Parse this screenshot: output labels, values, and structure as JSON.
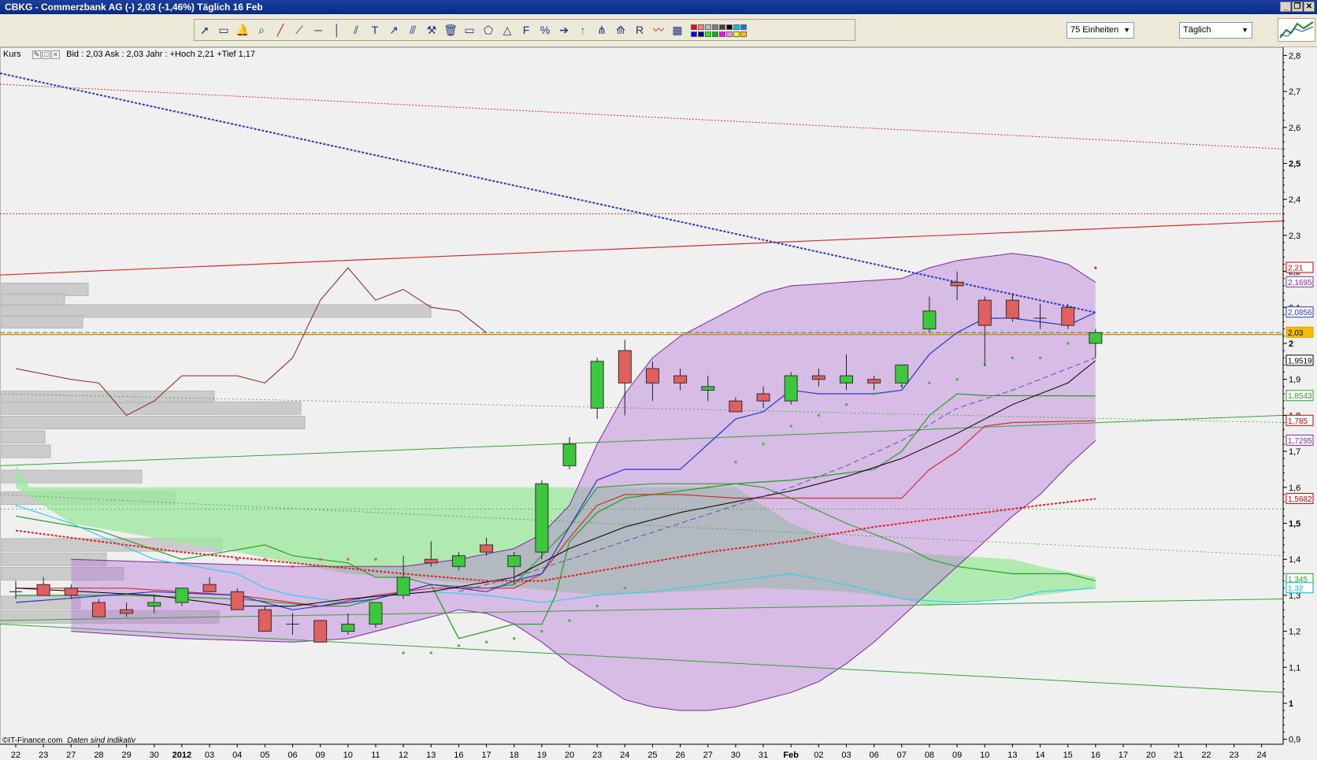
{
  "window": {
    "title": "CBKG - Commerzbank AG (-)   2,03 (-1,46%)   Täglich  16 Feb"
  },
  "toolbar": {
    "units_select": "75 Einheiten",
    "interval_select": "Täglich",
    "tools": [
      "cursor-icon",
      "ruler-icon",
      "alarm-bell-icon",
      "zoom-icon",
      "trendline-icon",
      "ray-icon",
      "horizontal-line-icon",
      "vertical-line-icon",
      "channel-icon",
      "text-icon",
      "arrow-line-icon",
      "parallel-icon",
      "tools-icon",
      "trash-icon",
      "rectangle-icon",
      "polygon-icon",
      "triangle-icon",
      "fibonacci-icon",
      "percent-icon",
      "arrow-right-icon",
      "arrow-up-icon",
      "fork-icon",
      "fan-icon",
      "raff-icon",
      "indicator-icon",
      "chart-type-icon"
    ],
    "colors": [
      "#ff0000",
      "#ff8080",
      "#c0c0c0",
      "#808080",
      "#404040",
      "#000000",
      "#00c0ff",
      "#0080ff",
      "#0000ff",
      "#000080",
      "#00ff00",
      "#00c000",
      "#ff00ff",
      "#ff80ff",
      "#ffff00",
      "#ffc000"
    ]
  },
  "info": {
    "label": "Kurs",
    "text": "Bid : 2,03 Ask : 2,03  Jahr : +Hoch 2,21 +Tief 1,17"
  },
  "footer": {
    "source": "©IT-Finance.com",
    "note": "Daten sind indikativ"
  },
  "chart_data": {
    "type": "candlestick",
    "x_tick_labels": [
      "22",
      "23",
      "27",
      "28",
      "29",
      "30",
      "2012",
      "03",
      "04",
      "05",
      "06",
      "09",
      "10",
      "11",
      "12",
      "13",
      "16",
      "17",
      "18",
      "19",
      "20",
      "23",
      "24",
      "25",
      "26",
      "27",
      "30",
      "31",
      "Feb",
      "02",
      "03",
      "06",
      "07",
      "08",
      "09",
      "10",
      "13",
      "14",
      "15",
      "16",
      "17",
      "20",
      "21",
      "22",
      "23",
      "24"
    ],
    "y_ticks": [
      0.9,
      1.0,
      1.1,
      1.2,
      1.3,
      1.4,
      1.5,
      1.6,
      1.7,
      1.8,
      1.9,
      2.0,
      2.1,
      2.2,
      2.3,
      2.4,
      2.5,
      2.6,
      2.7,
      2.8
    ],
    "y_tick_labels": [
      "0,9",
      "1",
      "1,1",
      "1,2",
      "1,3",
      "1,4",
      "1,5",
      "1,6",
      "1,7",
      "1,8",
      "1,9",
      "2",
      "2,1",
      "2,2",
      "2,3",
      "2,4",
      "2,5",
      "2,6",
      "2,7",
      "2,8"
    ],
    "y_bold_labels": [
      "1",
      "1,5",
      "2",
      "2,5"
    ],
    "ylim": [
      0.88,
      2.83
    ],
    "candles": [
      {
        "o": 1.31,
        "h": 1.34,
        "l": 1.29,
        "c": 1.31
      },
      {
        "o": 1.33,
        "h": 1.35,
        "l": 1.3,
        "c": 1.3
      },
      {
        "o": 1.32,
        "h": 1.33,
        "l": 1.29,
        "c": 1.3
      },
      {
        "o": 1.28,
        "h": 1.29,
        "l": 1.24,
        "c": 1.24
      },
      {
        "o": 1.26,
        "h": 1.28,
        "l": 1.24,
        "c": 1.25
      },
      {
        "o": 1.27,
        "h": 1.3,
        "l": 1.25,
        "c": 1.28
      },
      {
        "o": 1.28,
        "h": 1.32,
        "l": 1.27,
        "c": 1.32
      },
      {
        "o": 1.33,
        "h": 1.35,
        "l": 1.31,
        "c": 1.31
      },
      {
        "o": 1.31,
        "h": 1.32,
        "l": 1.26,
        "c": 1.26
      },
      {
        "o": 1.26,
        "h": 1.27,
        "l": 1.2,
        "c": 1.2
      },
      {
        "o": 1.22,
        "h": 1.25,
        "l": 1.19,
        "c": 1.22
      },
      {
        "o": 1.23,
        "h": 1.23,
        "l": 1.17,
        "c": 1.17
      },
      {
        "o": 1.2,
        "h": 1.25,
        "l": 1.19,
        "c": 1.22
      },
      {
        "o": 1.22,
        "h": 1.28,
        "l": 1.21,
        "c": 1.28
      },
      {
        "o": 1.3,
        "h": 1.41,
        "l": 1.29,
        "c": 1.35
      },
      {
        "o": 1.4,
        "h": 1.45,
        "l": 1.38,
        "c": 1.39
      },
      {
        "o": 1.38,
        "h": 1.42,
        "l": 1.37,
        "c": 1.41
      },
      {
        "o": 1.44,
        "h": 1.46,
        "l": 1.41,
        "c": 1.42
      },
      {
        "o": 1.38,
        "h": 1.42,
        "l": 1.33,
        "c": 1.41
      },
      {
        "o": 1.42,
        "h": 1.62,
        "l": 1.4,
        "c": 1.61
      },
      {
        "o": 1.66,
        "h": 1.74,
        "l": 1.65,
        "c": 1.72
      },
      {
        "o": 1.82,
        "h": 1.96,
        "l": 1.79,
        "c": 1.95
      },
      {
        "o": 1.98,
        "h": 2.01,
        "l": 1.8,
        "c": 1.89
      },
      {
        "o": 1.93,
        "h": 1.95,
        "l": 1.84,
        "c": 1.89
      },
      {
        "o": 1.91,
        "h": 1.93,
        "l": 1.87,
        "c": 1.89
      },
      {
        "o": 1.87,
        "h": 1.91,
        "l": 1.84,
        "c": 1.88
      },
      {
        "o": 1.84,
        "h": 1.85,
        "l": 1.81,
        "c": 1.81
      },
      {
        "o": 1.86,
        "h": 1.88,
        "l": 1.82,
        "c": 1.84
      },
      {
        "o": 1.84,
        "h": 1.92,
        "l": 1.83,
        "c": 1.91
      },
      {
        "o": 1.91,
        "h": 1.93,
        "l": 1.88,
        "c": 1.9
      },
      {
        "o": 1.89,
        "h": 1.97,
        "l": 1.87,
        "c": 1.91
      },
      {
        "o": 1.9,
        "h": 1.91,
        "l": 1.87,
        "c": 1.89
      },
      {
        "o": 1.89,
        "h": 1.94,
        "l": 1.88,
        "c": 1.94
      },
      {
        "o": 2.04,
        "h": 2.13,
        "l": 2.03,
        "c": 2.09
      },
      {
        "o": 2.17,
        "h": 2.2,
        "l": 2.12,
        "c": 2.16
      },
      {
        "o": 2.12,
        "h": 2.13,
        "l": 1.94,
        "c": 2.05
      },
      {
        "o": 2.12,
        "h": 2.14,
        "l": 2.06,
        "c": 2.07
      },
      {
        "o": 2.07,
        "h": 2.11,
        "l": 2.04,
        "c": 2.07
      },
      {
        "o": 2.1,
        "h": 2.11,
        "l": 2.04,
        "c": 2.05
      },
      {
        "o": 2.0,
        "h": 2.04,
        "l": 1.96,
        "c": 2.03
      }
    ],
    "price_labels": [
      {
        "text": "2,21",
        "value": 2.21,
        "color": "#cc0000"
      },
      {
        "text": "2,1695",
        "value": 2.17,
        "color": "#8a2a9a"
      },
      {
        "text": "2,0856",
        "value": 2.086,
        "color": "#2a36c8"
      },
      {
        "text": "2,03",
        "value": 2.03,
        "color": "#e0a000"
      },
      {
        "text": "1,9519",
        "value": 1.952,
        "color": "#000000"
      },
      {
        "text": "1,8543",
        "value": 1.854,
        "color": "#2aa02a"
      },
      {
        "text": "1,785",
        "value": 1.785,
        "color": "#cc0000"
      },
      {
        "text": "1,7295",
        "value": 1.73,
        "color": "#8a2a9a"
      },
      {
        "text": "1,5682",
        "value": 1.568,
        "color": "#cc0000"
      },
      {
        "text": "1,345",
        "value": 1.345,
        "color": "#2aa02a"
      },
      {
        "text": "1,32",
        "value": 1.32,
        "color": "#00b8d8"
      }
    ]
  }
}
